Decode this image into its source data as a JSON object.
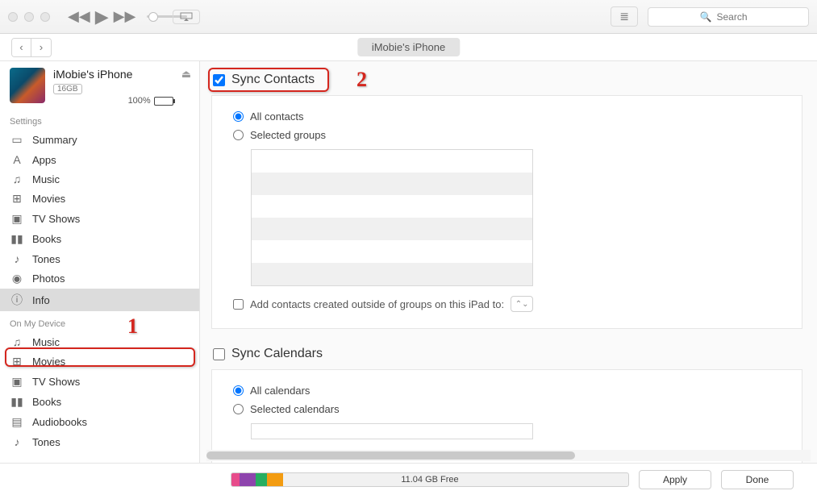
{
  "search": {
    "placeholder": "Search"
  },
  "subbar": {
    "device_pill": "iMobie's iPhone"
  },
  "device": {
    "name": "iMobie's iPhone",
    "capacity_badge": "16GB",
    "battery_pct": "100%"
  },
  "sidebar": {
    "sections": {
      "settings_label": "Settings",
      "on_device_label": "On My Device"
    },
    "settings": [
      {
        "icon": "▭",
        "label": "Summary"
      },
      {
        "icon": "A",
        "label": "Apps"
      },
      {
        "icon": "♫",
        "label": "Music"
      },
      {
        "icon": "⊞",
        "label": "Movies"
      },
      {
        "icon": "▣",
        "label": "TV Shows"
      },
      {
        "icon": "▮▮",
        "label": "Books"
      },
      {
        "icon": "♪",
        "label": "Tones"
      },
      {
        "icon": "◉",
        "label": "Photos"
      },
      {
        "icon": "ⓘ",
        "label": "Info"
      }
    ],
    "on_device": [
      {
        "icon": "♫",
        "label": "Music"
      },
      {
        "icon": "⊞",
        "label": "Movies"
      },
      {
        "icon": "▣",
        "label": "TV Shows"
      },
      {
        "icon": "▮▮",
        "label": "Books"
      },
      {
        "icon": "▤",
        "label": "Audiobooks"
      },
      {
        "icon": "♪",
        "label": "Tones"
      }
    ]
  },
  "main": {
    "sync_contacts": {
      "title": "Sync Contacts",
      "checked": true,
      "opt_all": "All contacts",
      "opt_selected": "Selected groups",
      "add_outside_label": "Add contacts created outside of groups on this iPad to:"
    },
    "sync_calendars": {
      "title": "Sync Calendars",
      "checked": false,
      "opt_all": "All calendars",
      "opt_selected": "Selected calendars"
    }
  },
  "footer": {
    "free_label": "11.04 GB Free",
    "segments": [
      {
        "color": "#e74c8b",
        "pct": 2
      },
      {
        "color": "#8e44ad",
        "pct": 4
      },
      {
        "color": "#27ae60",
        "pct": 3
      },
      {
        "color": "#f39c12",
        "pct": 4
      }
    ],
    "apply": "Apply",
    "done": "Done"
  },
  "annotations": {
    "n1": "1",
    "n2": "2"
  }
}
